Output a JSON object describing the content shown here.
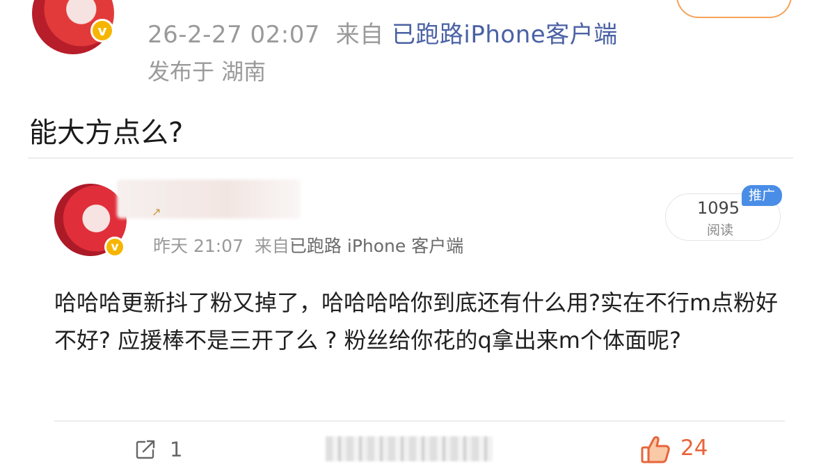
{
  "post": {
    "timestamp": "26-2-27 02:07",
    "source_prefix": "来自",
    "source": "已跑路iPhone客户端",
    "location": "发布于 湖南",
    "text": "能大方点么?"
  },
  "repost": {
    "timestamp": "昨天 21:07",
    "source_prefix": "来自",
    "source": "已跑路 iPhone 客户端",
    "read_count": "1095",
    "read_label": "阅读",
    "promo_tag": "推广",
    "text": "哈哈哈更新抖了粉又掉了，哈哈哈哈你到底还有什么用?实在不行m点粉好不好? 应援棒不是三开了么 ? 粉丝给你花的q拿出来m个体面呢?"
  },
  "actions": {
    "share_count": "1",
    "like_count": "24"
  },
  "badges": {
    "verified": "v"
  },
  "colors": {
    "source_link": "#4a61a4",
    "like": "#e8643a",
    "promo": "#4a8de6",
    "verified_badge": "#f6b500"
  },
  "icons": [
    "share-icon",
    "thumbs-up-icon",
    "verified-badge-icon"
  ]
}
